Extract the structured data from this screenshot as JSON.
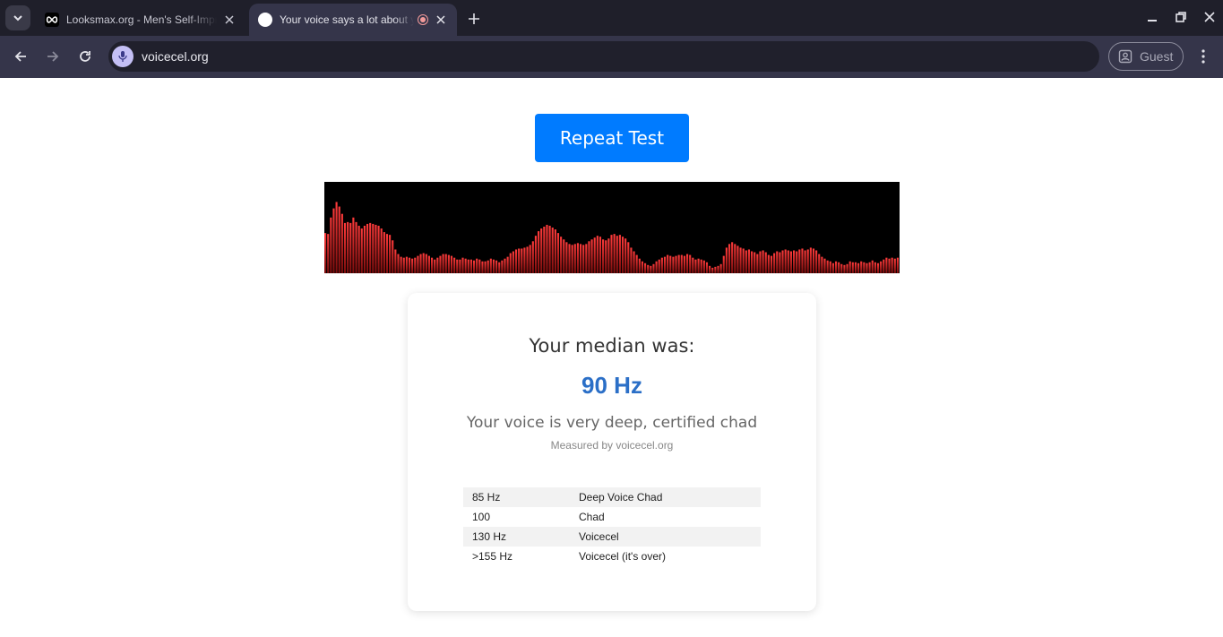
{
  "browser": {
    "tabs": [
      {
        "title": "Looksmax.org - Men's Self-Improvement",
        "active": false,
        "icon": "infinity-icon"
      },
      {
        "title": "Your voice says a lot about you",
        "active": true,
        "icon": "globe-icon",
        "recording": true
      }
    ],
    "url": "voicecel.org",
    "profile_label": "Guest"
  },
  "page": {
    "repeat_button": "Repeat Test",
    "median_label": "Your median was:",
    "median_value": "90 Hz",
    "verdict": "Your voice is very deep, certified chad",
    "measured_by": "Measured by voicecel.org",
    "reference_table": [
      {
        "pitch": "85 Hz",
        "label": "Deep Voice Chad"
      },
      {
        "pitch": "100",
        "label": "Chad"
      },
      {
        "pitch": "130 Hz",
        "label": "Voicecel"
      },
      {
        "pitch": ">155 Hz",
        "label": "Voicecel (it's over)"
      }
    ]
  },
  "spectrum": {
    "color_top": "#ff3b3b",
    "color_bottom": "#7a0c0c",
    "levels": [
      0.44,
      0.43,
      0.61,
      0.71,
      0.78,
      0.73,
      0.65,
      0.55,
      0.56,
      0.55,
      0.61,
      0.56,
      0.52,
      0.49,
      0.52,
      0.54,
      0.55,
      0.54,
      0.53,
      0.52,
      0.49,
      0.45,
      0.43,
      0.42,
      0.36,
      0.26,
      0.21,
      0.18,
      0.17,
      0.18,
      0.17,
      0.16,
      0.17,
      0.19,
      0.21,
      0.22,
      0.21,
      0.19,
      0.17,
      0.15,
      0.17,
      0.19,
      0.21,
      0.21,
      0.2,
      0.19,
      0.17,
      0.15,
      0.15,
      0.17,
      0.16,
      0.15,
      0.15,
      0.14,
      0.16,
      0.15,
      0.13,
      0.13,
      0.14,
      0.16,
      0.15,
      0.14,
      0.12,
      0.14,
      0.16,
      0.18,
      0.22,
      0.24,
      0.26,
      0.27,
      0.27,
      0.28,
      0.29,
      0.31,
      0.35,
      0.41,
      0.46,
      0.49,
      0.51,
      0.53,
      0.52,
      0.5,
      0.48,
      0.44,
      0.4,
      0.37,
      0.34,
      0.32,
      0.31,
      0.32,
      0.33,
      0.32,
      0.31,
      0.32,
      0.35,
      0.37,
      0.39,
      0.41,
      0.4,
      0.37,
      0.36,
      0.38,
      0.42,
      0.43,
      0.41,
      0.42,
      0.4,
      0.38,
      0.34,
      0.28,
      0.24,
      0.2,
      0.16,
      0.13,
      0.11,
      0.09,
      0.08,
      0.1,
      0.13,
      0.15,
      0.17,
      0.18,
      0.2,
      0.19,
      0.18,
      0.19,
      0.2,
      0.2,
      0.19,
      0.21,
      0.2,
      0.17,
      0.15,
      0.16,
      0.15,
      0.14,
      0.12,
      0.08,
      0.06,
      0.07,
      0.08,
      0.1,
      0.19,
      0.28,
      0.32,
      0.34,
      0.32,
      0.3,
      0.28,
      0.27,
      0.25,
      0.26,
      0.24,
      0.23,
      0.21,
      0.24,
      0.25,
      0.23,
      0.2,
      0.19,
      0.22,
      0.24,
      0.23,
      0.25,
      0.26,
      0.25,
      0.24,
      0.25,
      0.24,
      0.26,
      0.27,
      0.25,
      0.26,
      0.28,
      0.27,
      0.25,
      0.21,
      0.18,
      0.16,
      0.14,
      0.13,
      0.11,
      0.13,
      0.12,
      0.1,
      0.09,
      0.1,
      0.13,
      0.12,
      0.12,
      0.11,
      0.13,
      0.12,
      0.11,
      0.12,
      0.14,
      0.12,
      0.11,
      0.13,
      0.15,
      0.17,
      0.16,
      0.17,
      0.16,
      0.17
    ]
  }
}
